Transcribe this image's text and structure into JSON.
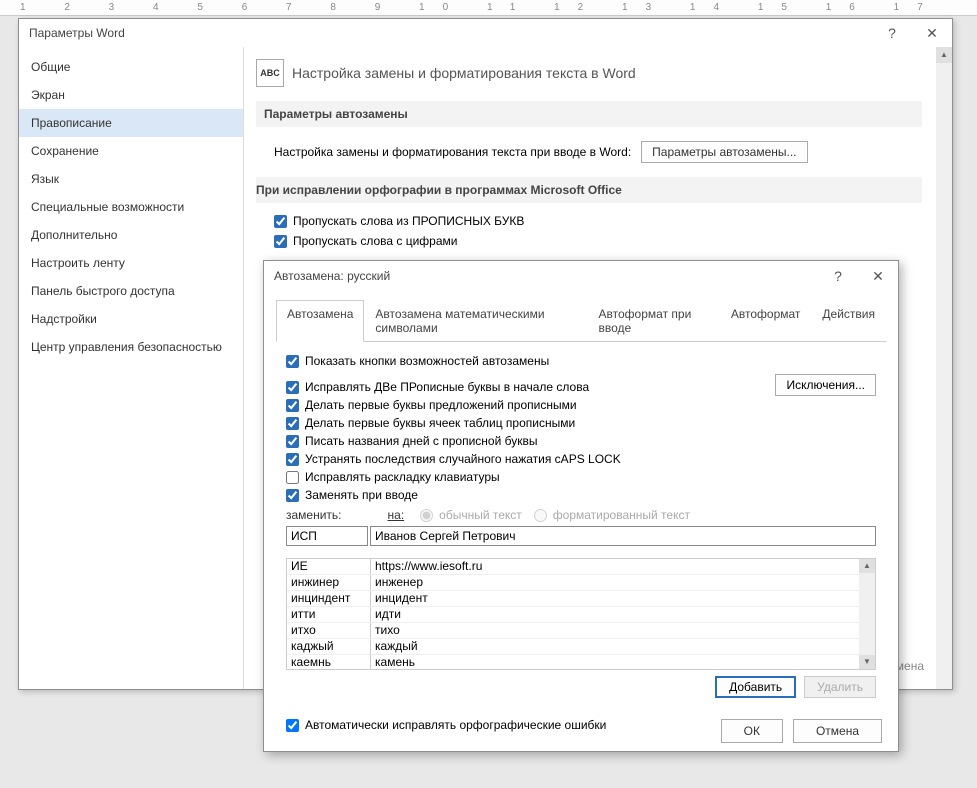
{
  "ruler": "1 2 3 4 5 6 7 8 9 10 11 12 13 14 15 16 17",
  "options": {
    "title": "Параметры Word",
    "sidebar": [
      "Общие",
      "Экран",
      "Правописание",
      "Сохранение",
      "Язык",
      "Специальные возможности",
      "Дополнительно",
      "Настроить ленту",
      "Панель быстрого доступа",
      "Надстройки",
      "Центр управления безопасностью"
    ],
    "selectedIndex": 2,
    "main": {
      "headerTitle": "Настройка замены и форматирования текста в Word",
      "abc": "ABC",
      "sec1": "Параметры автозамены",
      "sec1_label": "Настройка замены и форматирования текста при вводе в Word:",
      "sec1_btn": "Параметры автозамены...",
      "sec2": "При исправлении орфографии в программах Microsoft Office",
      "chk1": "Пропускать слова из ПРОПИСНЫХ БУКВ",
      "chk2": "Пропускать слова с цифрами",
      "hiddenBtn": "мена"
    }
  },
  "auto": {
    "title": "Автозамена: русский",
    "tabs": [
      "Автозамена",
      "Автозамена математическими символами",
      "Автоформат при вводе",
      "Автоформат",
      "Действия"
    ],
    "activeTab": 0,
    "chk_show": "Показать кнопки возможностей автозамены",
    "chk_two_caps": "Исправлять ДВе ПРописные буквы в начале слова",
    "chk_sentence": "Делать первые буквы предложений прописными",
    "chk_cells": "Делать первые буквы ячеек таблиц прописными",
    "chk_days": "Писать названия дней с прописной буквы",
    "chk_caps": "Устранять последствия случайного нажатия cAPS LOCK",
    "chk_layout": "Исправлять раскладку клавиатуры",
    "chk_replace": "Заменять при вводе",
    "exceptions": "Исключения...",
    "lbl_replace": "заменить:",
    "lbl_with": "на:",
    "radio_plain": "обычный текст",
    "radio_formatted": "форматированный текст",
    "input_replace": "ИСП",
    "input_with": "Иванов Сергей Петрович",
    "list": [
      [
        "ИЕ",
        "https://www.iesoft.ru"
      ],
      [
        "инжинер",
        "инженер"
      ],
      [
        "инциндент",
        "инцидент"
      ],
      [
        "итти",
        "идти"
      ],
      [
        "итхо",
        "тихо"
      ],
      [
        "каджый",
        "каждый"
      ],
      [
        "каемнь",
        "камень"
      ]
    ],
    "btn_add": "Добавить",
    "btn_delete": "Удалить",
    "chk_auto_spell": "Автоматически исправлять орфографические ошибки",
    "btn_ok": "ОК",
    "btn_cancel": "Отмена"
  }
}
